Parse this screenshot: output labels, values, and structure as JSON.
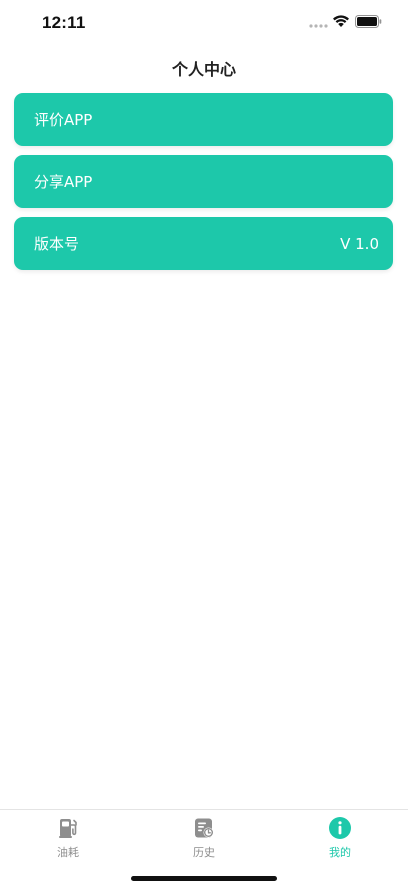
{
  "status_bar": {
    "time": "12:11"
  },
  "header": {
    "title": "个人中心"
  },
  "menu": {
    "items": [
      {
        "label": "评价APP",
        "value": ""
      },
      {
        "label": "分享APP",
        "value": ""
      },
      {
        "label": "版本号",
        "value": "V 1.0"
      }
    ]
  },
  "tab_bar": {
    "tabs": [
      {
        "label": "油耗",
        "icon": "fuel-pump-icon",
        "active": false
      },
      {
        "label": "历史",
        "icon": "history-icon",
        "active": false
      },
      {
        "label": "我的",
        "icon": "info-icon",
        "active": true
      }
    ]
  },
  "colors": {
    "accent": "#1dc8aa",
    "tab_inactive": "#8e8e8e",
    "background": "#ffffff"
  }
}
